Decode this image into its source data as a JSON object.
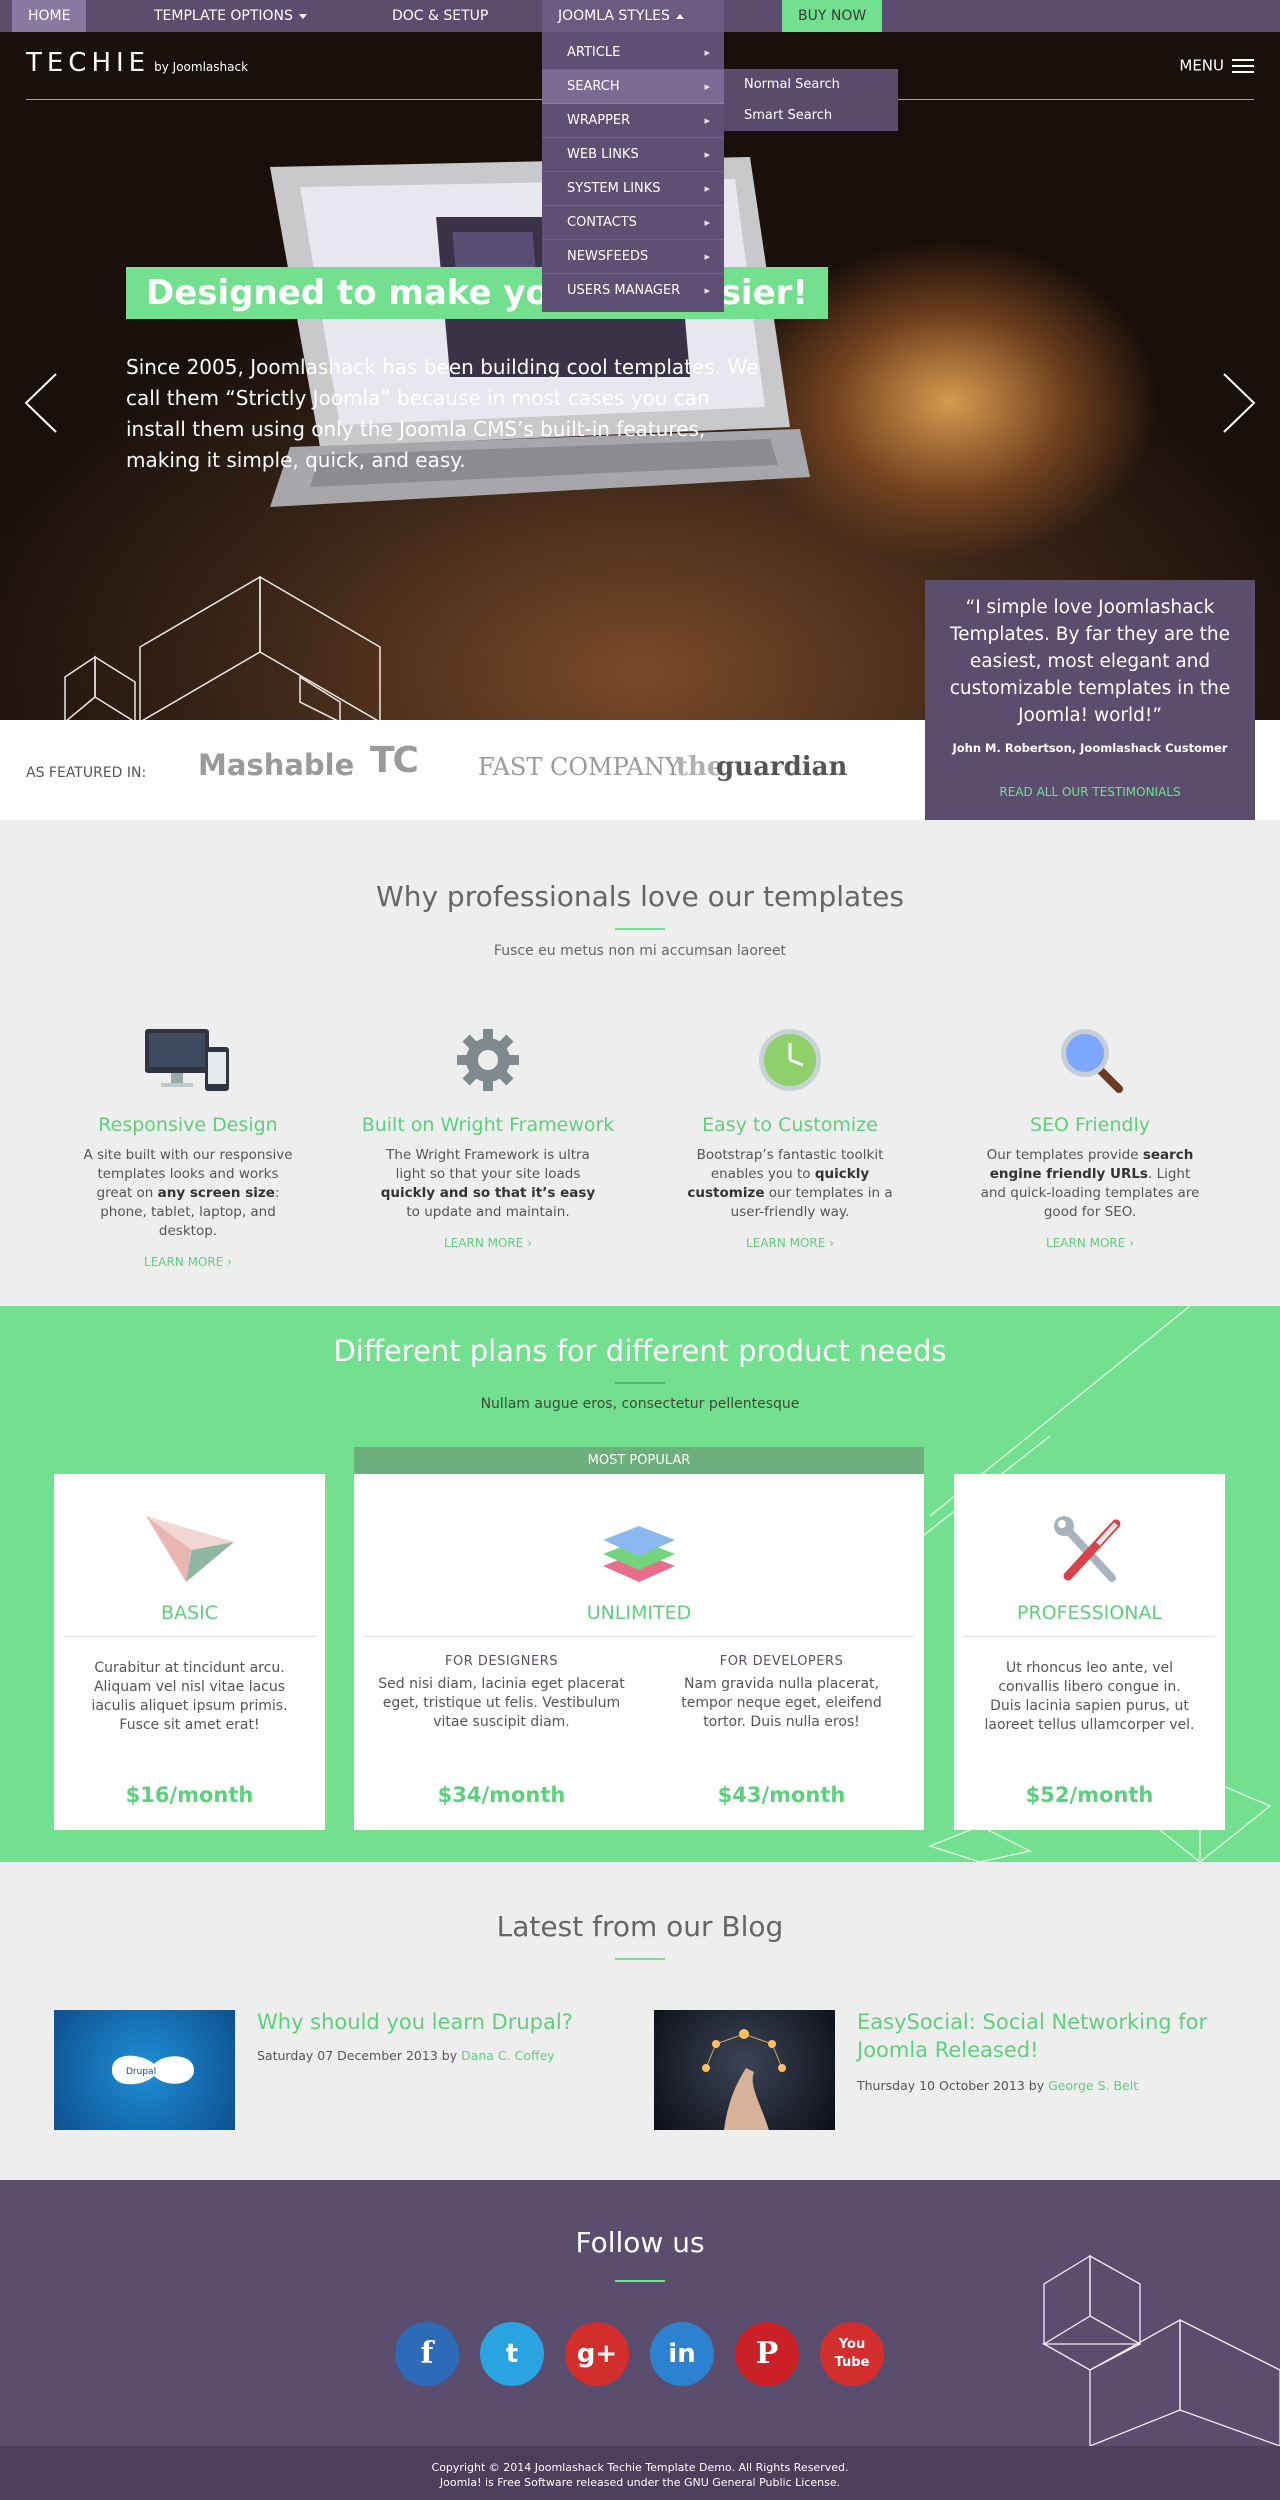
{
  "nav": {
    "items": [
      "HOME",
      "TEMPLATE OPTIONS",
      "DOC & SETUP",
      "JOOMLA STYLES",
      "BUY NOW"
    ],
    "dropdown": [
      "ARTICLE",
      "SEARCH",
      "WRAPPER",
      "WEB LINKS",
      "SYSTEM LINKS",
      "CONTACTS",
      "NEWSFEEDS",
      "USERS MANAGER"
    ],
    "submenu": [
      "Normal Search",
      "Smart Search"
    ]
  },
  "brand": {
    "logo": "TECHIE",
    "by": "by Joomlashack",
    "menu": "MENU"
  },
  "hero": {
    "title": "Designed to make your life easier!",
    "text": "Since 2005, Joomlashack has been building cool templates. We call them “Strictly Joomla” because in most cases you can install them using only the Joomla CMS’s built-in features, making it simple, quick, and easy."
  },
  "testimonial": {
    "quote": "“I simple love Joomlashack Templates. By far they are the easiest, most elegant and customizable templates in the Joomla! world!”",
    "author": "John M. Robertson, Joomlashack Customer",
    "link": "READ ALL OUR TESTIMONIALS"
  },
  "featured": {
    "label": "AS FEATURED IN:",
    "brands": [
      "Mashable",
      "TC",
      "FAST COMPANY",
      "the",
      "guardian"
    ]
  },
  "why": {
    "title": "Why professionals love our templates",
    "subtitle": "Fusce eu metus non mi accumsan laoreet",
    "items": [
      {
        "title": "Responsive Design",
        "t1": "A site built with our responsive templates looks and works great on ",
        "b1": "any screen size",
        "t2": ": phone, tablet, laptop, and desktop.",
        "b2": "",
        "t3": "",
        "more": "LEARN MORE ›"
      },
      {
        "title": "Built on Wright Framework",
        "t1": "The Wright Framework is ultra light so that your site loads ",
        "b1": "quickly and so that it’s easy",
        "t2": " to update and maintain.",
        "b2": "",
        "t3": "",
        "more": "LEARN MORE ›"
      },
      {
        "title": "Easy to Customize",
        "t1": "Bootstrap’s fantastic toolkit enables you to ",
        "b1": "quickly customize",
        "t2": " our templates in a user-friendly way.",
        "b2": "",
        "t3": "",
        "more": "LEARN MORE ›"
      },
      {
        "title": "SEO Friendly",
        "t1": "Our templates provide ",
        "b1": "search engine friendly URLs",
        "t2": ". Light and quick-loading templates are good for SEO.",
        "b2": "",
        "t3": "",
        "more": "LEARN MORE ›"
      }
    ]
  },
  "plans": {
    "title": "Different plans for different product needs",
    "subtitle": "Nullam augue eros, consectetur pellentesque",
    "popular": "MOST POPULAR",
    "basic": {
      "name": "BASIC",
      "text": "Curabitur at tincidunt arcu. Aliquam vel nisl vitae lacus iaculis aliquet ipsum primis. Fusce sit amet erat!",
      "price": "$16/month"
    },
    "unlimited": {
      "name": "UNLIMITED",
      "designers": {
        "label": "FOR DESIGNERS",
        "text": "Sed nisi diam, lacinia eget placerat eget, tristique ut felis. Vestibulum vitae suscipit diam.",
        "price": "$34/month"
      },
      "developers": {
        "label": "FOR DEVELOPERS",
        "text": "Nam gravida nulla placerat, tempor neque eget, eleifend tortor. Duis nulla eros!",
        "price": "$43/month"
      }
    },
    "professional": {
      "name": "PROFESSIONAL",
      "text": "Ut rhoncus leo ante, vel convallis libero congue in. Duis lacinia sapien purus, ut laoreet tellus ullamcorper vel.",
      "price": "$52/month"
    }
  },
  "blog": {
    "title": "Latest from our Blog",
    "posts": [
      {
        "title": "Why should you learn Drupal?",
        "date": "Saturday 07 December 2013 by ",
        "author": "Dana C. Coffey",
        "img": "Drupal"
      },
      {
        "title": "EasySocial: Social Networking for Joomla Released!",
        "date": "Thursday 10 October 2013 by ",
        "author": "George S. Belt"
      }
    ]
  },
  "follow": {
    "title": "Follow us",
    "icons": [
      "f",
      "t",
      "g+",
      "in",
      "P",
      "You Tube"
    ]
  },
  "footer": {
    "line1": "Copyright © 2014 Joomlashack Techie Template Demo. All Rights Reserved.",
    "line2": "Joomla! is Free Software released under the GNU General Public License."
  },
  "colors": {
    "purple": "#5b4d6d",
    "green": "#73e08f",
    "accent_text": "#5fcf7e"
  }
}
